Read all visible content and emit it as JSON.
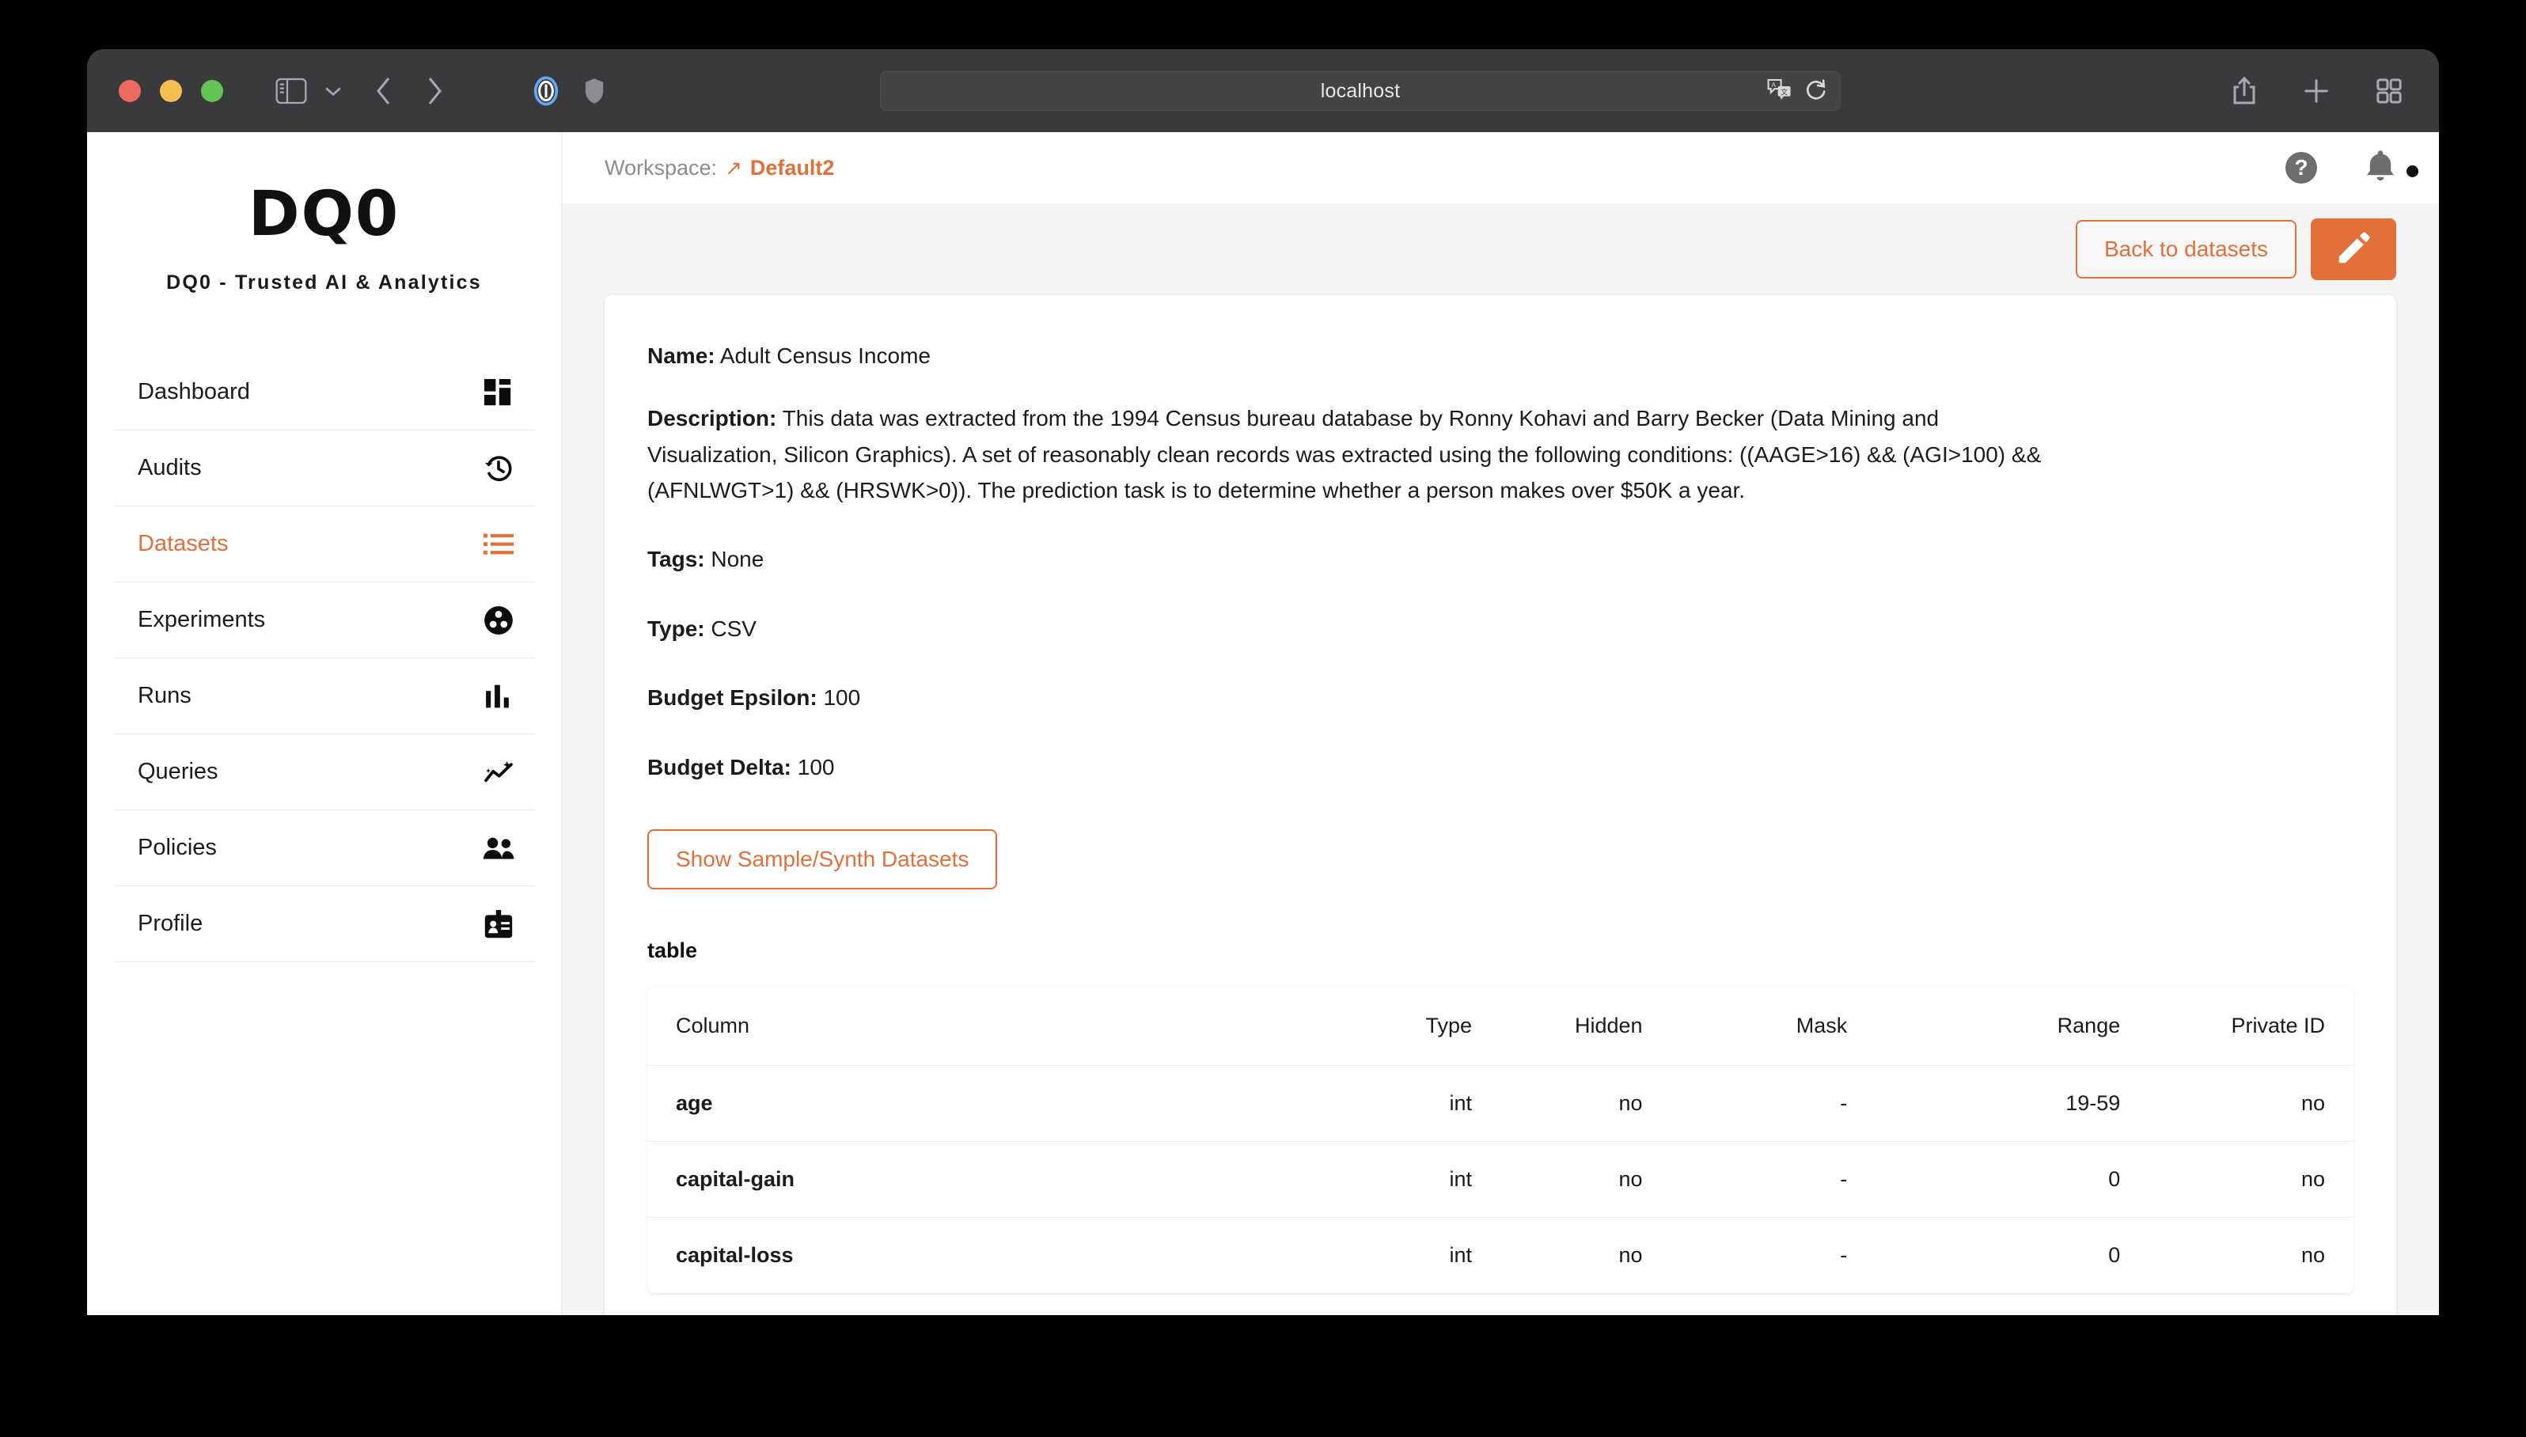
{
  "browser": {
    "url": "localhost",
    "icons": {
      "sidebar_toggle": "sidebar-toggle-icon",
      "chevron": "chevron-down-icon",
      "back": "back-arrow-icon",
      "forward": "forward-arrow-icon",
      "reader": "reader-view-icon",
      "shield": "privacy-shield-icon",
      "translate": "translate-icon",
      "reload": "reload-icon",
      "share": "share-icon",
      "new_tab": "plus-icon",
      "tab_overview": "tab-overview-icon"
    }
  },
  "sidebar": {
    "logo": "DQ0",
    "tagline": "DQ0 - Trusted AI & Analytics",
    "items": [
      {
        "label": "Dashboard",
        "icon": "dashboard-grid-icon",
        "active": false
      },
      {
        "label": "Audits",
        "icon": "history-clock-icon",
        "active": false
      },
      {
        "label": "Datasets",
        "icon": "list-icon",
        "active": true
      },
      {
        "label": "Experiments",
        "icon": "experiments-icon",
        "active": false
      },
      {
        "label": "Runs",
        "icon": "bar-chart-icon",
        "active": false
      },
      {
        "label": "Queries",
        "icon": "query-sparkline-icon",
        "active": false
      },
      {
        "label": "Policies",
        "icon": "people-icon",
        "active": false
      },
      {
        "label": "Profile",
        "icon": "id-badge-icon",
        "active": false
      }
    ]
  },
  "header": {
    "workspace_label": "Workspace:",
    "workspace_arrow": "↗",
    "workspace_name": "Default2",
    "help_icon": "help-icon",
    "help_glyph": "?",
    "notifications_icon": "bell-icon"
  },
  "actions": {
    "back_to_datasets": "Back to datasets",
    "edit_icon": "edit-pencil-icon"
  },
  "dataset": {
    "name_label": "Name:",
    "name_value": "Adult Census Income",
    "description_label": "Description:",
    "description_value": "This data was extracted from the 1994 Census bureau database by Ronny Kohavi and Barry Becker (Data Mining and Visualization, Silicon Graphics). A set of reasonably clean records was extracted using the following conditions: ((AAGE>16) && (AGI>100) && (AFNLWGT>1) && (HRSWK>0)). The prediction task is to determine whether a person makes over $50K a year.",
    "tags_label": "Tags:",
    "tags_value": "None",
    "type_label": "Type:",
    "type_value": "CSV",
    "budget_epsilon_label": "Budget Epsilon:",
    "budget_epsilon_value": "100",
    "budget_delta_label": "Budget Delta:",
    "budget_delta_value": "100",
    "show_sample_button": "Show Sample/Synth Datasets"
  },
  "table": {
    "title": "table",
    "headers": {
      "column": "Column",
      "type": "Type",
      "hidden": "Hidden",
      "mask": "Mask",
      "range": "Range",
      "private_id": "Private ID"
    },
    "rows": [
      {
        "column": "age",
        "type": "int",
        "hidden": "no",
        "mask": "-",
        "range": "19-59",
        "private_id": "no"
      },
      {
        "column": "capital-gain",
        "type": "int",
        "hidden": "no",
        "mask": "-",
        "range": "0",
        "private_id": "no"
      },
      {
        "column": "capital-loss",
        "type": "int",
        "hidden": "no",
        "mask": "-",
        "range": "0",
        "private_id": "no"
      }
    ]
  },
  "colors": {
    "accent": "#e2703a",
    "page_bg": "#f4f4f4",
    "chrome": "#3a3a3c"
  }
}
